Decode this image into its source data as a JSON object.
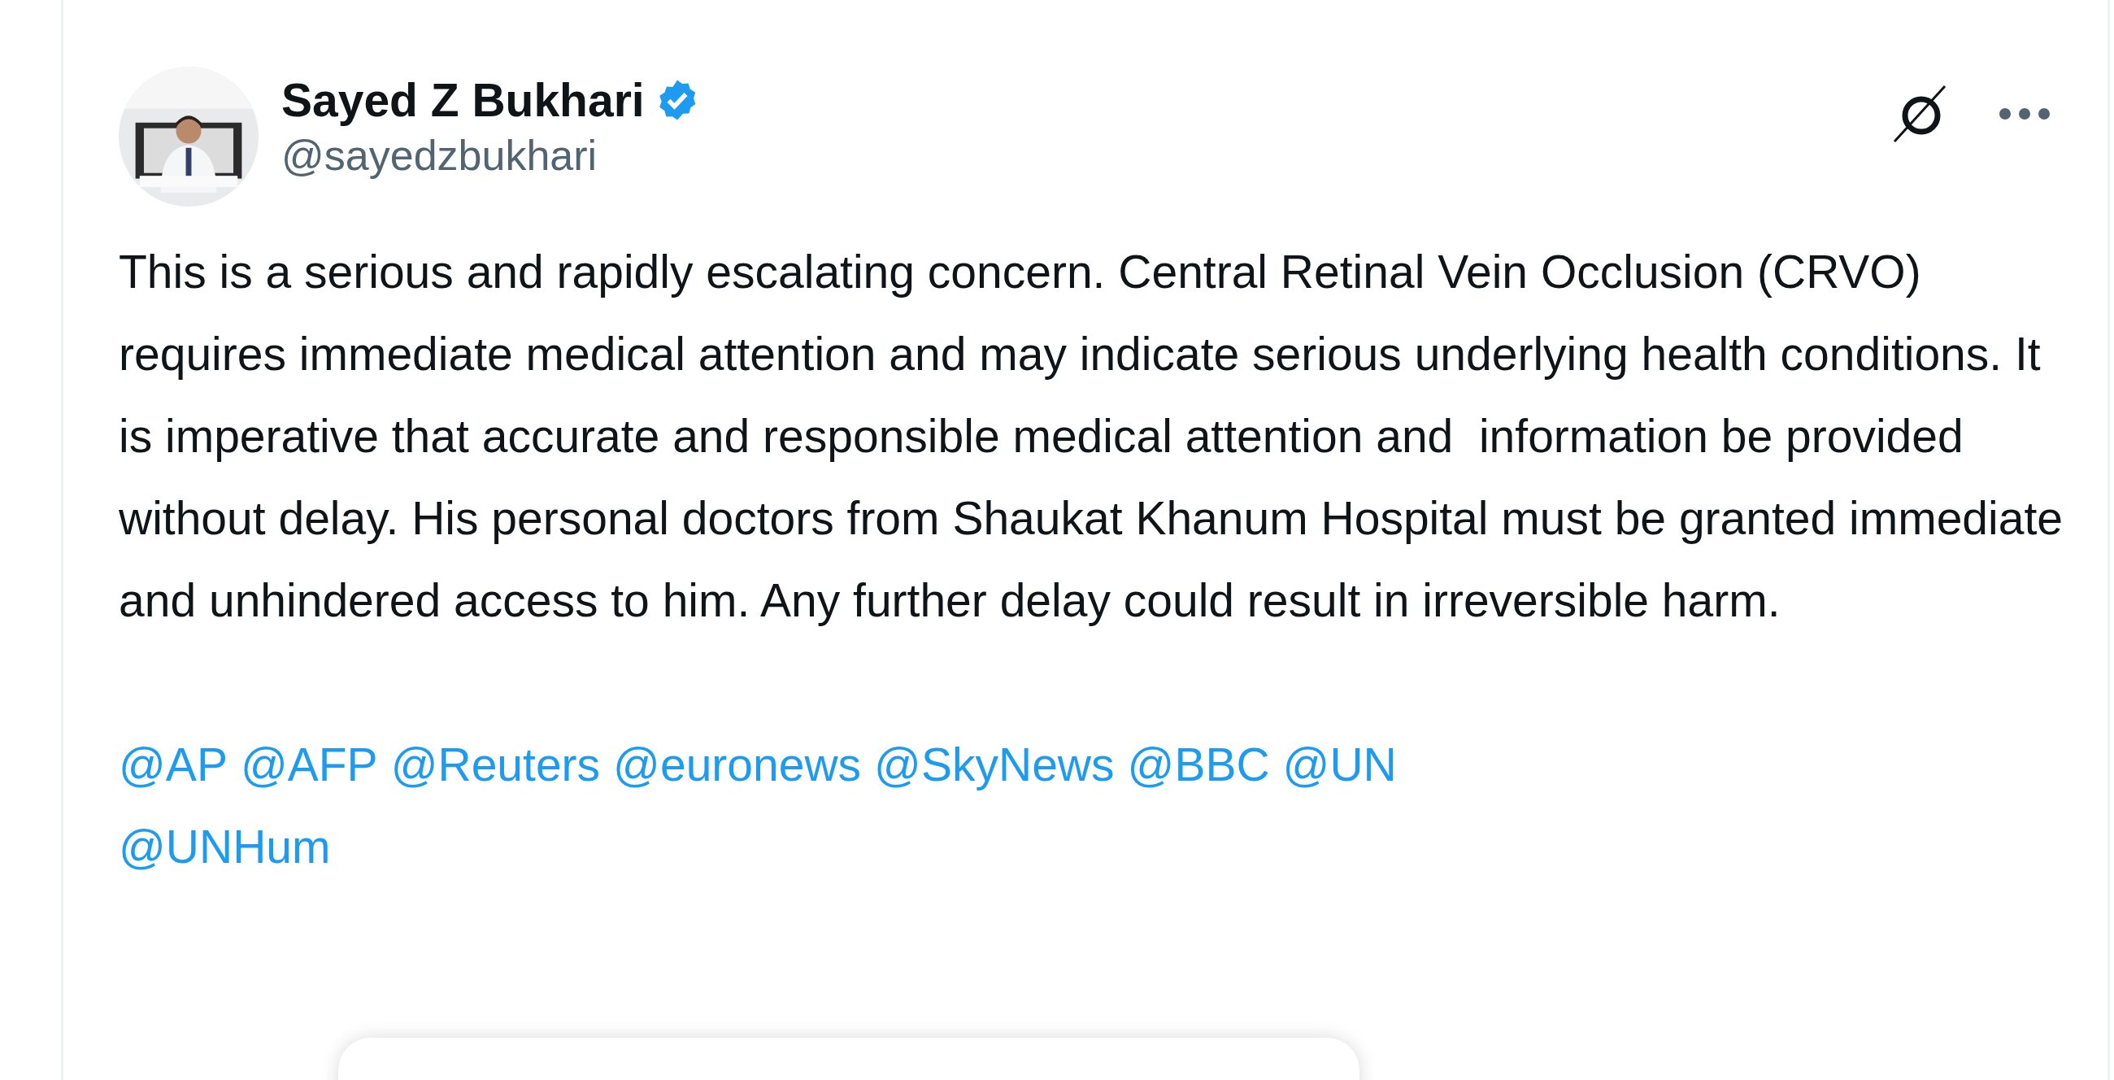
{
  "author": {
    "name": "Sayed Z Bukhari",
    "verified": true,
    "handle": "@sayedzbukhari"
  },
  "text": "This is a serious and rapidly escalating concern. Central Retinal Vein Occlusion (CRVO) requires immediate medical attention and may indicate serious underlying health conditions. It is imperative that accurate and responsible medical attention and  information be provided without delay. His personal doctors from Shaukat Khanum Hospital must be granted immediate and unhindered access to him. Any further delay could result in irreversible harm.",
  "mentions": [
    [
      "@AP",
      "@AFP",
      "@Reuters",
      "@euronews",
      "@SkyNews",
      "@BBC",
      "@UN"
    ],
    [
      "@UNHum"
    ]
  ]
}
